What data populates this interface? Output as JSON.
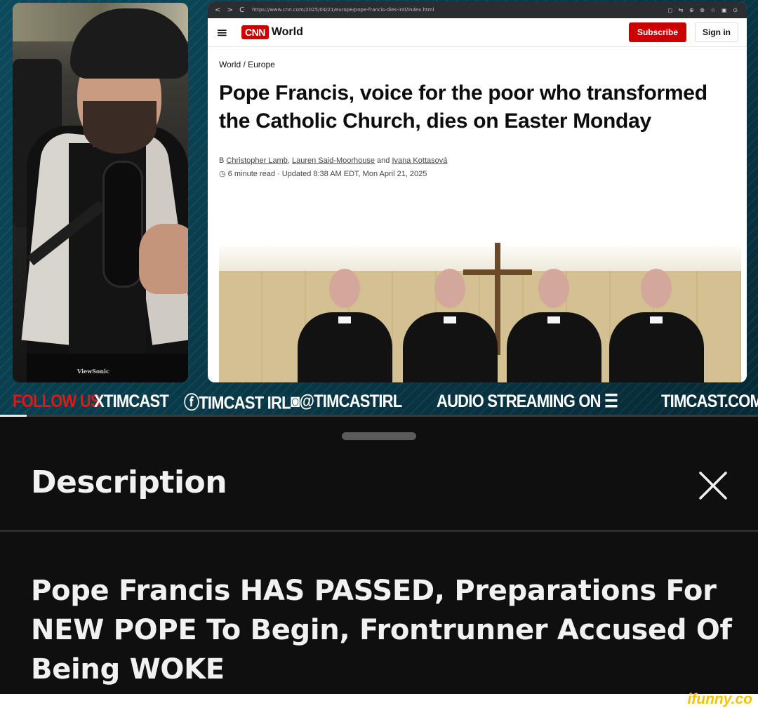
{
  "browser": {
    "nav_glyphs": "< > C",
    "url": "https://www.cnn.com/2025/04/21/europe/pope-francis-dies-intl/index.html",
    "toolbar_glyphs": "◻ ⇆ ⊕ ⊗ ☆ ▣ ⊙"
  },
  "cnn": {
    "menu_icon": "≡",
    "logo_text": "CNN",
    "section": "World",
    "subscribe_label": "Subscribe",
    "signin_label": "Sign in",
    "breadcrumb": "World / Europe",
    "headline": "Pope Francis, voice for the poor who transformed the Catholic Church, dies on Easter Monday",
    "byline_prefix": "B",
    "authors": [
      "Christopher Lamb",
      "Lauren Said-Moorhouse",
      "Ivana Kottasová"
    ],
    "byline_sep": ", ",
    "byline_and": " and ",
    "read_time": "6 minute read",
    "updated": "Updated 8:38 AM EDT, Mon April 21, 2025"
  },
  "webcam": {
    "monitor_brand": "ViewSonic"
  },
  "ticker": {
    "follow": "FOLLOW US",
    "x": "XTIMCAST",
    "fb": "TIMCAST IRL",
    "ig": "@TIMCASTIRL",
    "audio": "AUDIO STREAMING ON",
    "site": "TIMCAST.COM"
  },
  "player": {
    "progress": 0.035
  },
  "sheet": {
    "title": "Description",
    "video_title": "Pope Francis HAS PASSED, Preparations For NEW POPE To Begin, Frontrunner Accused Of Being WOKE"
  },
  "watermark": "ifunny.co",
  "colors": {
    "cnn_red": "#cc0000",
    "ticker_red": "#e01818",
    "sheet_bg": "#0f0f0f",
    "watermark": "#f2c20a"
  }
}
